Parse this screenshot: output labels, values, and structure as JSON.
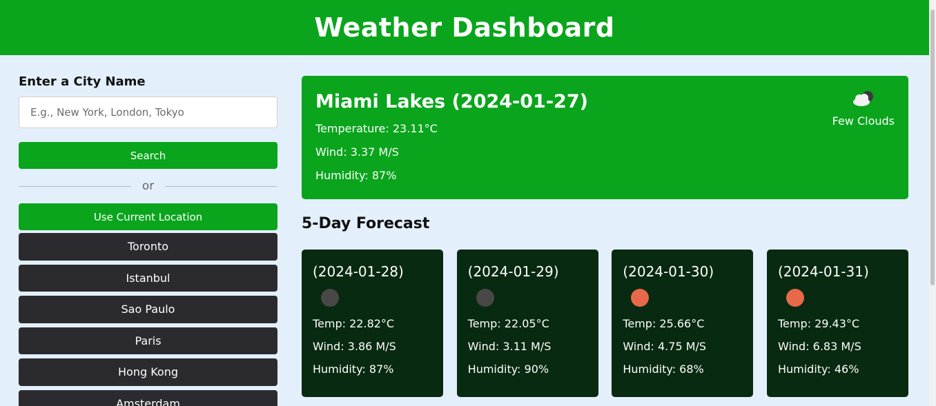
{
  "header": {
    "title": "Weather Dashboard"
  },
  "search": {
    "label": "Enter a City Name",
    "placeholder": "E.g., New York, London, Tokyo",
    "value": "",
    "search_button": "Search",
    "or_text": "or",
    "location_button": "Use Current Location"
  },
  "history": [
    {
      "label": "Toronto"
    },
    {
      "label": "Istanbul"
    },
    {
      "label": "Sao Paulo"
    },
    {
      "label": "Paris"
    },
    {
      "label": "Hong Kong"
    },
    {
      "label": "Amsterdam"
    }
  ],
  "current": {
    "title": "Miami Lakes (2024-01-27)",
    "temperature": "Temperature: 23.11°C",
    "wind": "Wind: 3.37 M/S",
    "humidity": "Humidity: 87%",
    "condition": "Few Clouds",
    "condition_icon": "few-clouds-icon"
  },
  "forecast": {
    "title": "5-Day Forecast",
    "days": [
      {
        "date": "(2024-01-28)",
        "icon": "moon-icon",
        "icon_color": "#4a4748",
        "temp": "Temp: 22.82°C",
        "wind": "Wind: 3.86 M/S",
        "humidity": "Humidity: 87%"
      },
      {
        "date": "(2024-01-29)",
        "icon": "moon-icon",
        "icon_color": "#4a4748",
        "temp": "Temp: 22.05°C",
        "wind": "Wind: 3.11 M/S",
        "humidity": "Humidity: 90%"
      },
      {
        "date": "(2024-01-30)",
        "icon": "sun-icon",
        "icon_color": "#e8694a",
        "temp": "Temp: 25.66°C",
        "wind": "Wind: 4.75 M/S",
        "humidity": "Humidity: 68%"
      },
      {
        "date": "(2024-01-31)",
        "icon": "sun-icon",
        "icon_color": "#e8694a",
        "temp": "Temp: 29.43°C",
        "wind": "Wind: 6.83 M/S",
        "humidity": "Humidity: 46%"
      }
    ]
  },
  "colors": {
    "accent": "#0aa51c",
    "card_dark": "#082a10",
    "history_button": "#2b2b2f",
    "background": "#e3f0fb"
  }
}
